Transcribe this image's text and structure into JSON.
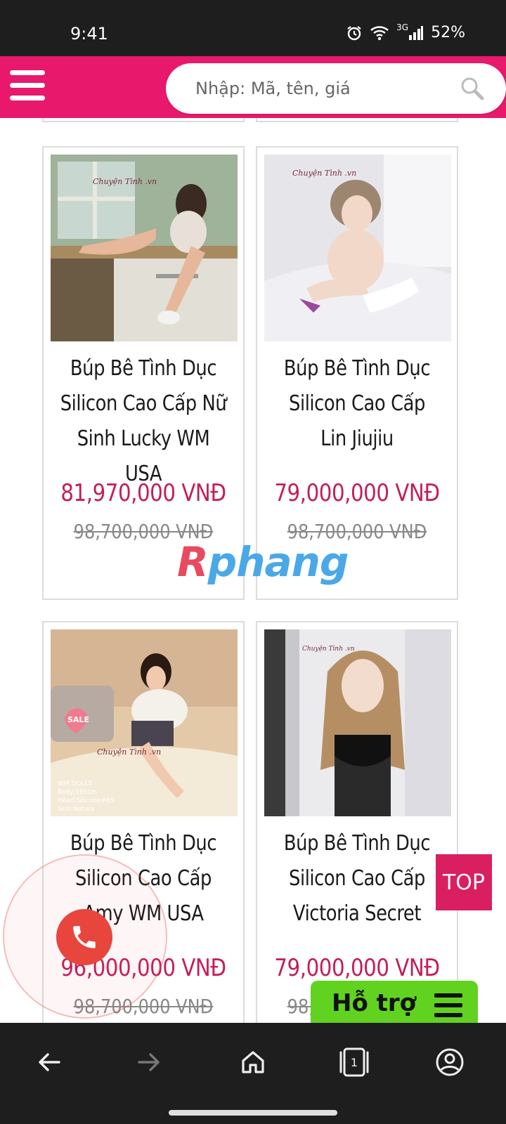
{
  "status": {
    "time": "9:41",
    "network": "3G",
    "battery": "52%"
  },
  "search": {
    "placeholder": "Nhập: Mã, tên, giá"
  },
  "products": [
    {
      "name": "Búp Bê Tình Dục Silicon Cao Cấp Nữ Sinh Lucky WM USA",
      "price": "81,970,000 VNĐ",
      "old_price": "98,700,000 VNĐ",
      "image": "product-photo",
      "logo_text": "Chuyện Tình .vn"
    },
    {
      "name": "Búp Bê Tình Dục Silicon Cao Cấp Lin Jiujiu",
      "price": "79,000,000 VNĐ",
      "old_price": "98,700,000 VNĐ",
      "image": "product-photo",
      "logo_text": "Chuyện Tình .vn"
    },
    {
      "name": "Búp Bê Tình Dục Silicon Cao Cấp Amy WM USA",
      "price": "96,000,000 VNĐ",
      "old_price": "98,700,000 VNĐ",
      "image": "product-photo",
      "badge": "SALE",
      "logo_text": "Chuyện Tình .vn",
      "spec_lines": [
        "WM DOLLS",
        "Body:165cm",
        "Head:Silicone#85",
        "Skin:Nature"
      ]
    },
    {
      "name": "Búp Bê Tình Dục Silicon Cao Cấp Victoria Secret",
      "price": "79,000,000 VNĐ",
      "old_price": "98,700,000 VNĐ",
      "image": "product-photo",
      "logo_text": "Chuyện Tình .vn"
    }
  ],
  "watermark": {
    "part1": "R",
    "part2": "phang"
  },
  "floating": {
    "top_label": "TOP",
    "support_label": "Hỗ trợ"
  },
  "nav": {
    "tab_count": "1"
  },
  "colors": {
    "brand": "#e8186c",
    "price": "#c41d59",
    "support": "#62d220",
    "call": "#e8453c"
  }
}
